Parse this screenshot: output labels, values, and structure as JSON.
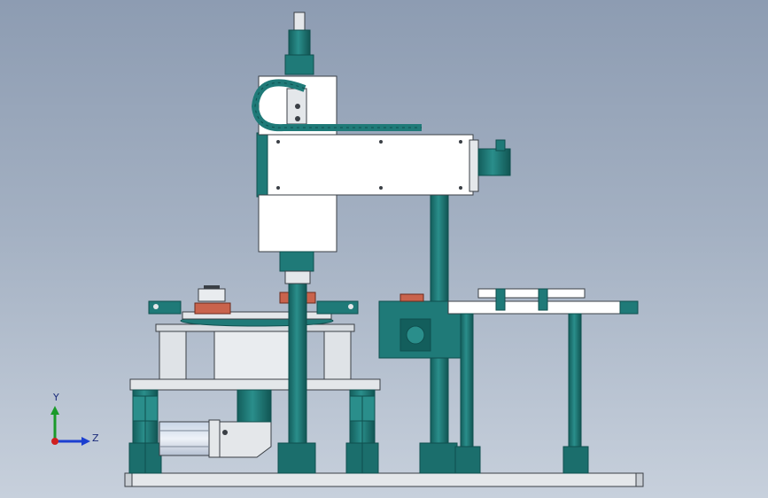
{
  "view": {
    "type": "cad-front-view",
    "background_top": "#8d9cb2",
    "background_bottom": "#c7d0dc"
  },
  "colors": {
    "teal": "#1f7a78",
    "teal_dark": "#0f4f4e",
    "plate": "#e4e7ea",
    "plate_edge": "#3a3f45",
    "steel": "#b9c0c8",
    "accent_red": "#c9634c",
    "axis_x": "#d02020",
    "axis_y": "#1a9a2a",
    "axis_z": "#1b3fd0"
  },
  "triad": {
    "y_label": "Y",
    "z_label": "Z",
    "y_icon": "axis-y-arrow",
    "z_icon": "axis-z-arrow",
    "x_icon": "axis-x-dot"
  }
}
